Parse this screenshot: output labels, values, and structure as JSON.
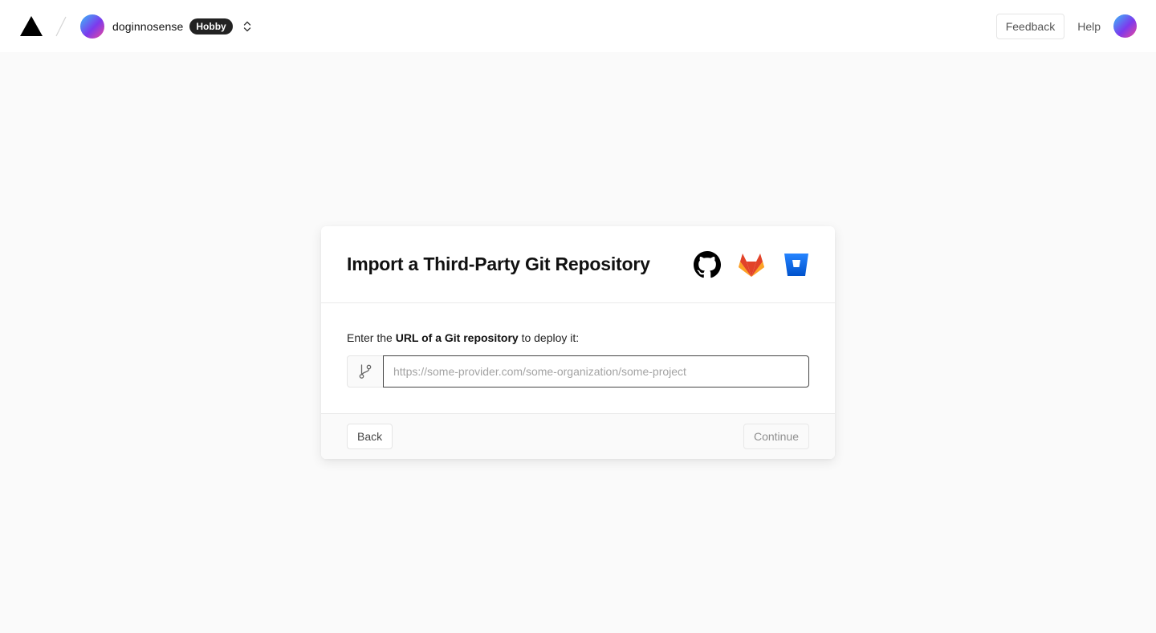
{
  "header": {
    "team_name": "doginnosense",
    "plan_badge": "Hobby",
    "feedback_label": "Feedback",
    "help_label": "Help"
  },
  "icons": {
    "logo": "vercel-logo-icon",
    "team_switcher": "chevron-up-down-icon",
    "providers": [
      "github-icon",
      "gitlab-icon",
      "bitbucket-icon"
    ],
    "url_prefix": "git-branch-icon"
  },
  "card": {
    "title": "Import a Third-Party Git Repository",
    "instruction_prefix": "Enter the ",
    "instruction_bold": "URL of a Git repository",
    "instruction_suffix": " to deploy it:",
    "url_input_value": "",
    "url_input_placeholder": "https://some-provider.com/some-organization/some-project",
    "back_label": "Back",
    "continue_label": "Continue"
  },
  "colors": {
    "background": "#fafafa",
    "badge_bg": "#222222",
    "github": "#000000",
    "gitlab_primary": "#e24329",
    "gitlab_secondary": "#fc6d26",
    "gitlab_tertiary": "#fca326",
    "bitbucket": "#2684ff"
  }
}
